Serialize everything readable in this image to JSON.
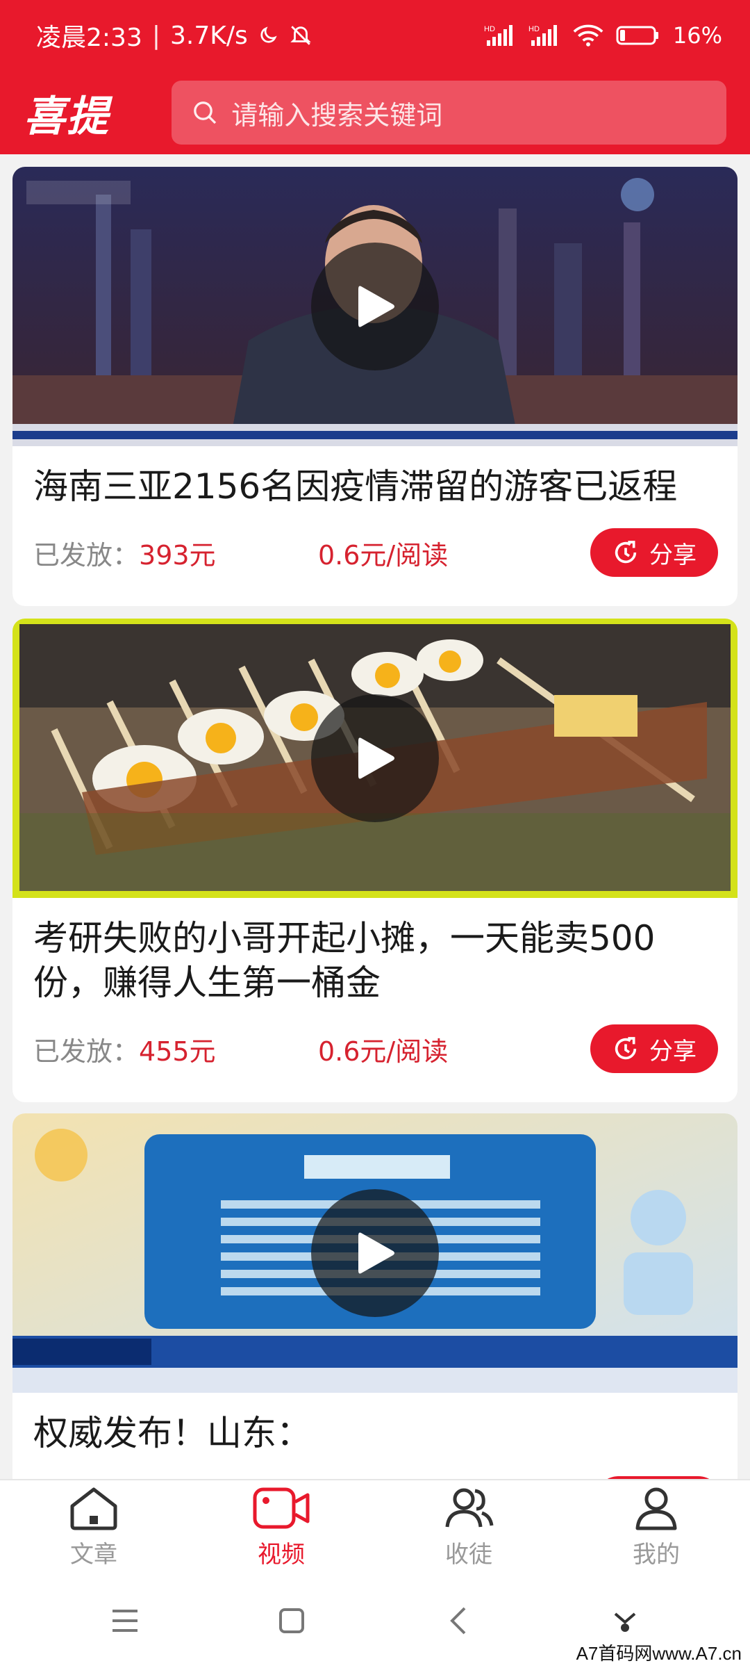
{
  "status_bar": {
    "time": "凌晨2:33",
    "net_speed": "3.7K/s",
    "battery": "16%",
    "icons": [
      "moon-icon",
      "mute-icon",
      "hd-signal-icon",
      "hd-signal-icon",
      "wifi-icon",
      "battery-icon"
    ]
  },
  "header": {
    "logo": "喜提",
    "search_placeholder": "请输入搜索关键词"
  },
  "feed": {
    "published_label": "已发放：",
    "items": [
      {
        "title": "海南三亚2156名因疫情滞留的游客已返程",
        "amount": "393元",
        "rate": "0.6元/阅读",
        "share": "分享"
      },
      {
        "title": "考研失败的小哥开起小摊，一天能卖500份，赚得人生第一桶金",
        "amount": "455元",
        "rate": "0.6元/阅读",
        "share": "分享"
      },
      {
        "title": "权威发布！山东：",
        "amount": "",
        "rate": "",
        "share": ""
      }
    ]
  },
  "tabs": [
    {
      "label": "文章",
      "icon": "home-icon"
    },
    {
      "label": "视频",
      "icon": "video-icon",
      "active": true
    },
    {
      "label": "收徒",
      "icon": "users-icon"
    },
    {
      "label": "我的",
      "icon": "person-icon"
    }
  ],
  "watermark": "A7首码网www.A7.cn",
  "colors": {
    "brand": "#e8192c",
    "price": "#d6222f"
  }
}
